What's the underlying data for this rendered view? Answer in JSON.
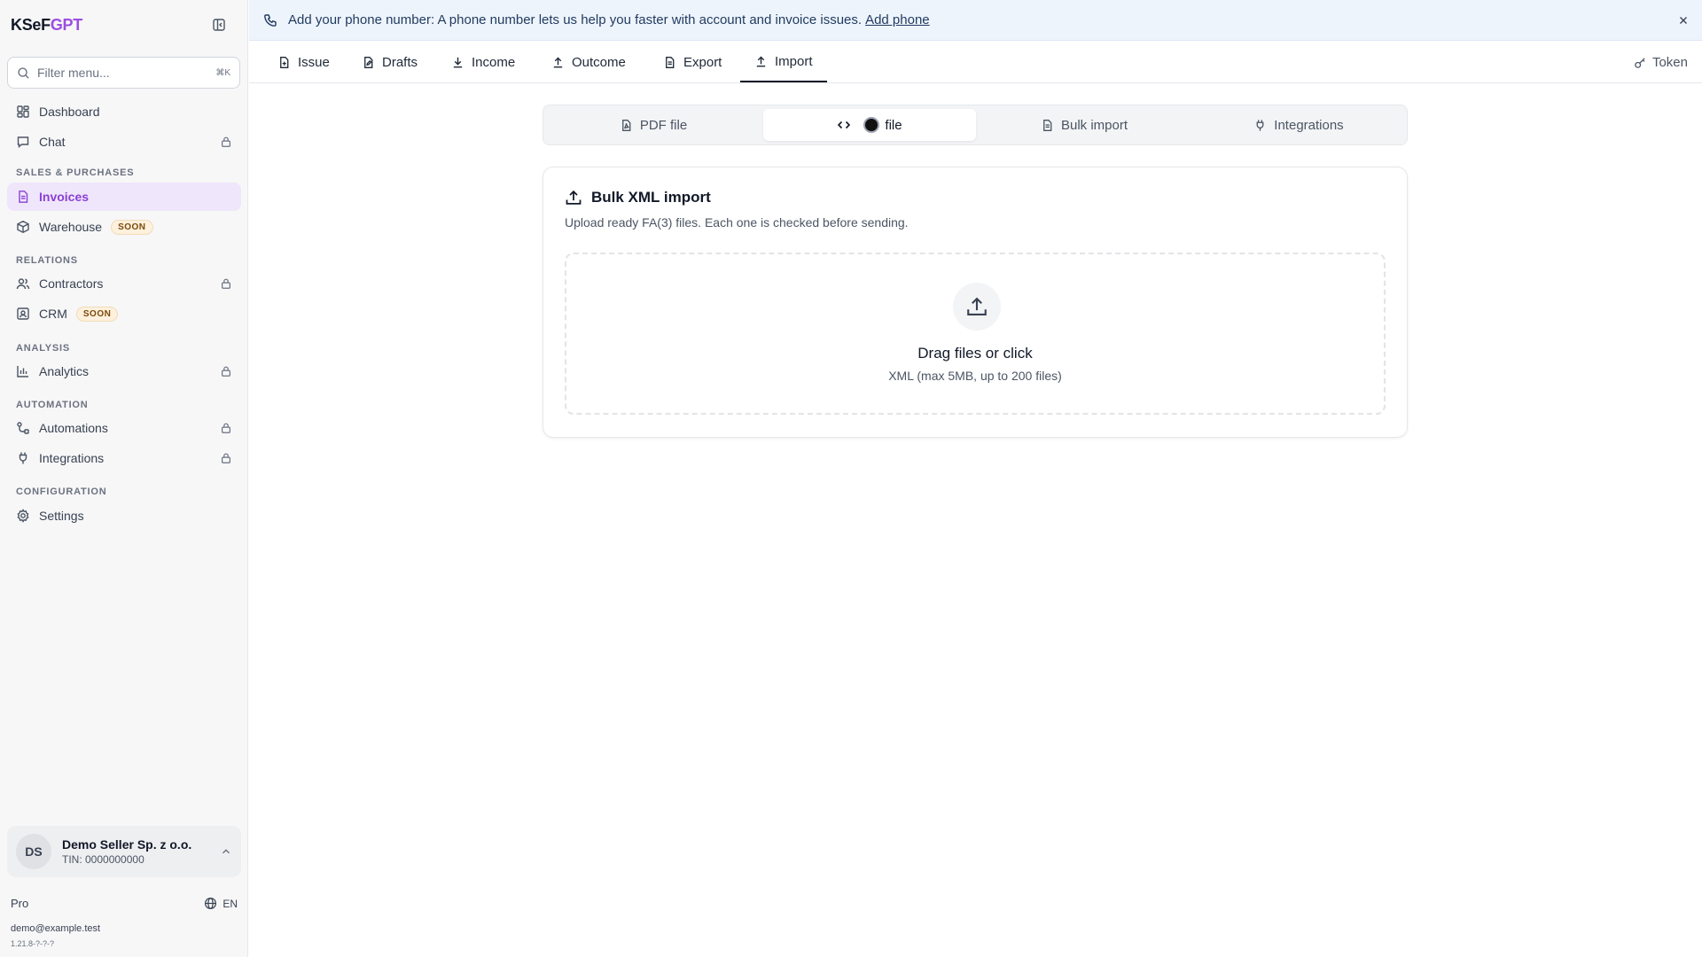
{
  "app": {
    "logo_primary": "KSeF",
    "logo_accent": "GPT"
  },
  "sidebar": {
    "filter_placeholder": "Filter menu...",
    "filter_shortcut": "⌘K",
    "items": {
      "dashboard": {
        "label": "Dashboard",
        "icon": "dashboard-icon"
      },
      "chat": {
        "label": "Chat",
        "icon": "chat-icon",
        "locked": true
      },
      "invoices": {
        "label": "Invoices",
        "icon": "invoice-icon",
        "active": true
      },
      "warehouse": {
        "label": "Warehouse",
        "icon": "box-icon",
        "badge": "SOON"
      },
      "contractors": {
        "label": "Contractors",
        "icon": "users-icon",
        "locked": true
      },
      "crm": {
        "label": "CRM",
        "icon": "contact-icon",
        "badge": "SOON"
      },
      "analytics": {
        "label": "Analytics",
        "icon": "bar-chart-icon",
        "locked": true
      },
      "automations": {
        "label": "Automations",
        "icon": "workflow-icon",
        "locked": true
      },
      "integrations": {
        "label": "Integrations",
        "icon": "plug-icon",
        "locked": true
      },
      "settings": {
        "label": "Settings",
        "icon": "gear-icon"
      }
    },
    "sections": {
      "sales": "SALES & PURCHASES",
      "relations": "RELATIONS",
      "analysis": "ANALYSIS",
      "automation": "AUTOMATION",
      "configuration": "CONFIGURATION"
    },
    "account": {
      "initials": "DS",
      "name": "Demo Seller Sp. z o.o.",
      "tin": "TIN: 0000000000"
    },
    "plan": "Pro",
    "language": "EN",
    "email": "demo@example.test",
    "version": "1.21.8-?-?-?"
  },
  "banner": {
    "text": "Add your phone number: A phone number lets us help you faster with account and invoice issues.",
    "link": "Add phone"
  },
  "tabs": {
    "issue": "Issue",
    "drafts": "Drafts",
    "income": "Income",
    "outcome": "Outcome",
    "export": "Export",
    "import": "Import",
    "active": "Import",
    "token": "Token"
  },
  "import_modes": {
    "pdf": "PDF file",
    "xml": "file",
    "bulk": "Bulk import",
    "integrations": "Integrations",
    "active": "xml"
  },
  "card": {
    "title": "Bulk XML import",
    "description": "Upload ready FA(3) files. Each one is checked before sending.",
    "drop_title": "Drag files or click",
    "drop_subtitle": "XML (max 5MB, up to 200 files)"
  },
  "colors": {
    "accent": "#8b3fd6",
    "active_bg": "#efe6fb",
    "banner_bg": "#eef4fc",
    "badge_bg": "#fdf0dc"
  }
}
